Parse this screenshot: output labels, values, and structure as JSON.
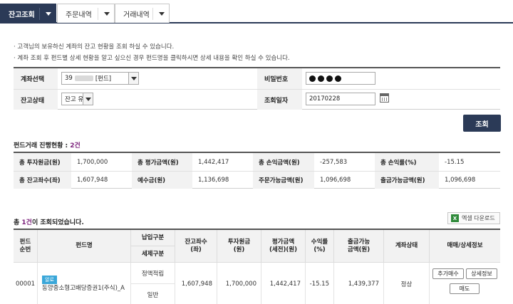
{
  "tabs": [
    {
      "label": "잔고조회",
      "active": true
    },
    {
      "label": "주문내역",
      "active": false
    },
    {
      "label": "거래내역",
      "active": false
    }
  ],
  "notices": [
    "· 고객님의 보유하신 계좌의 잔고 현황을 조회 하실 수 있습니다.",
    "· 계좌 조회 후 펀드별 상세 현황을 알고 싶으신 경우 펀드명을 클릭하시면 상세 내용을 확인 하실 수 있습니다."
  ],
  "form": {
    "account_label": "계좌선택",
    "account_prefix": "39",
    "account_suffix": "[펀드]",
    "password_label": "비밀번호",
    "balance_status_label": "잔고상태",
    "balance_status_value": "잔고 유",
    "inquiry_date_label": "조회일자",
    "inquiry_date_value": "20170228",
    "search_button": "조회"
  },
  "fund_status": {
    "title_prefix": "펀드거래 진행현황 : ",
    "count": "2건",
    "rows": [
      [
        {
          "label": "총 투자원금(원)",
          "value": "1,700,000"
        },
        {
          "label": "총 평가금액(원)",
          "value": "1,442,417"
        },
        {
          "label": "총 손익금액(원)",
          "value": "-257,583"
        },
        {
          "label": "총 손익률(%)",
          "value": "-15.15"
        }
      ],
      [
        {
          "label": "총 잔고좌수(좌)",
          "value": "1,607,948"
        },
        {
          "label": "예수금(원)",
          "value": "1,136,698"
        },
        {
          "label": "주문가능금액(원)",
          "value": "1,096,698"
        },
        {
          "label": "출금가능금액(원)",
          "value": "1,096,698"
        }
      ]
    ]
  },
  "result": {
    "count_prefix": "총 ",
    "count": "1건",
    "count_suffix": "이 조회되었습니다.",
    "excel_button": "엑셀 다운로드",
    "headers": {
      "fund_no": "펀드\n순번",
      "fund_name": "펀드명",
      "pay_type": "납입구분",
      "tax_type": "세제구분",
      "balance_units": "잔고좌수\n(좌)",
      "principal": "투자원금\n(원)",
      "valuation": "평가금액\n(세전)(원)",
      "return_rate": "수익률\n(%)",
      "withdrawable": "출금가능\n금액(원)",
      "account_status": "계좌상태",
      "actions": "매매/상세정보"
    },
    "rows": [
      {
        "fund_no": "00001",
        "badge": "알로",
        "fund_name": "동양중소형고배당증권1(주식)_A",
        "pay_type": "정액적립",
        "tax_type": "일반",
        "balance_units": "1,607,948",
        "principal": "1,700,000",
        "valuation": "1,442,417",
        "return_rate": "-15.15",
        "withdrawable": "1,439,377",
        "account_status": "정상",
        "buttons": {
          "additional_buy": "추가매수",
          "detail": "상세정보",
          "sell": "매도"
        }
      }
    ]
  }
}
